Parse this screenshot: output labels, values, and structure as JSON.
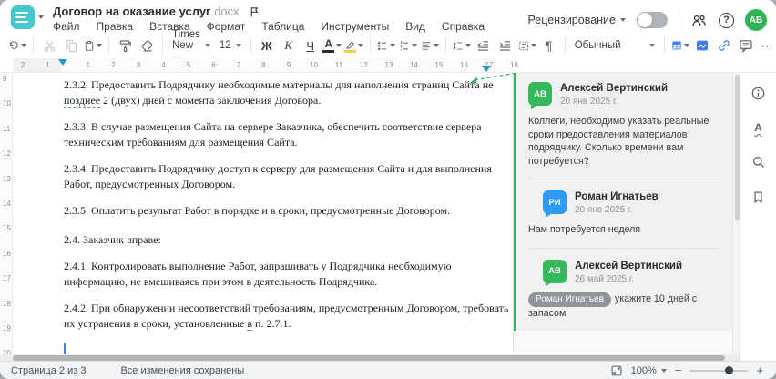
{
  "window": {
    "title": "Договор на оказание услуг",
    "ext": ".docx",
    "menus": [
      "Файл",
      "Правка",
      "Вставка",
      "Формат",
      "Таблица",
      "Инструменты",
      "Вид",
      "Справка"
    ],
    "review_label": "Рецензирование",
    "avatar_initials": "АВ"
  },
  "toolbar": {
    "font_family": "Times New ...",
    "font_size": "12",
    "bold": "Ж",
    "italic": "К",
    "underline": "Ч",
    "font_color_letter": "А",
    "style_name": "Обычный"
  },
  "icons": {
    "pilcrow": "¶",
    "more": "⋯",
    "question": "?",
    "spell_letter": "А",
    "minus": "−",
    "plus": "+"
  },
  "ruler": {
    "h_margin": [
      "2",
      "1"
    ],
    "h_content": [
      "1",
      "2",
      "3",
      "4",
      "5",
      "6",
      "7",
      "8",
      "9",
      "10",
      "11",
      "12",
      "13",
      "14",
      "15",
      "16",
      "17",
      "18"
    ],
    "v_numbers": [
      "9",
      "10",
      "11",
      "12",
      "13",
      "14",
      "15",
      "16",
      "17",
      "18",
      "19",
      "20"
    ]
  },
  "document": {
    "paragraphs": [
      {
        "runs": [
          {
            "t": "2.3.2. Предоставить Подрядчику необходимые материалы для наполнения страниц Сайта не\n"
          },
          {
            "t": "позднее",
            "u": true
          },
          {
            "t": " 2 (двух) дней с момента заключения Договора."
          }
        ]
      },
      {
        "runs": [
          {
            "t": "2.3.3. В случае размещения Сайта на сервере Заказчика, обеспечить соответствие сервера\nтехническим требованиям для размещения Сайта."
          }
        ]
      },
      {
        "runs": [
          {
            "t": "2.3.4. Предоставить Подрядчику доступ к серверу для размещения Сайта и для выполнения\nРабот, предусмотренных Договором."
          }
        ]
      },
      {
        "runs": [
          {
            "t": "2.3.5. Оплатить результат Работ в порядке и в сроки, предусмотренные Договором."
          }
        ]
      },
      {
        "gap": true,
        "runs": [
          {
            "t": "2.4. Заказчик вправе:"
          }
        ]
      },
      {
        "runs": [
          {
            "t": "2.4.1. Контролировать выполнение Работ, запрашивать у Подрядчика необходимую\nинформацию, не вмешиваясь при этом в деятельность Подрядчика."
          }
        ]
      },
      {
        "runs": [
          {
            "t": "2.4.2. При обнаружении несоответствий требованиям, предусмотренным Договором, требовать\nих устранения в сроки, установленные "
          },
          {
            "t": "в",
            "u": true
          },
          {
            "t": " п. 2.7.1."
          }
        ]
      }
    ]
  },
  "comments": {
    "thread": [
      {
        "initials": "АВ",
        "color": "#36b85c",
        "name": "Алексей Вертинский",
        "date": "20 янв 2025 г.",
        "text": "Коллеги, необходимо указать реальные сроки предоставления материалов подрядчику. Сколько времени вам потребуется?"
      },
      {
        "initials": "РИ",
        "color": "#2b9bf4",
        "name": "Роман Игнатьев",
        "date": "20 янв 2025 г.",
        "text": "Нам потребуется неделя",
        "reply": true
      },
      {
        "initials": "АВ",
        "color": "#36b85c",
        "name": "Алексей Вертинский",
        "date": "26 май 2025 г.",
        "mention": "Роман Игнатьев",
        "text": "укажите 10 дней с запасом",
        "reply": true
      }
    ]
  },
  "status_bar": {
    "page_info": "Страница 2 из 3",
    "save_status": "Все изменения сохранены",
    "zoom_value": "100%"
  },
  "colors": {
    "accent_teal": "#45c7d0",
    "green": "#35b45f",
    "blue": "#3f7ef0",
    "highlight_yellow": "#f2cf43",
    "font_color_current": "#2b2b2b",
    "ruler_marker_blue": "#1f9ad6"
  }
}
